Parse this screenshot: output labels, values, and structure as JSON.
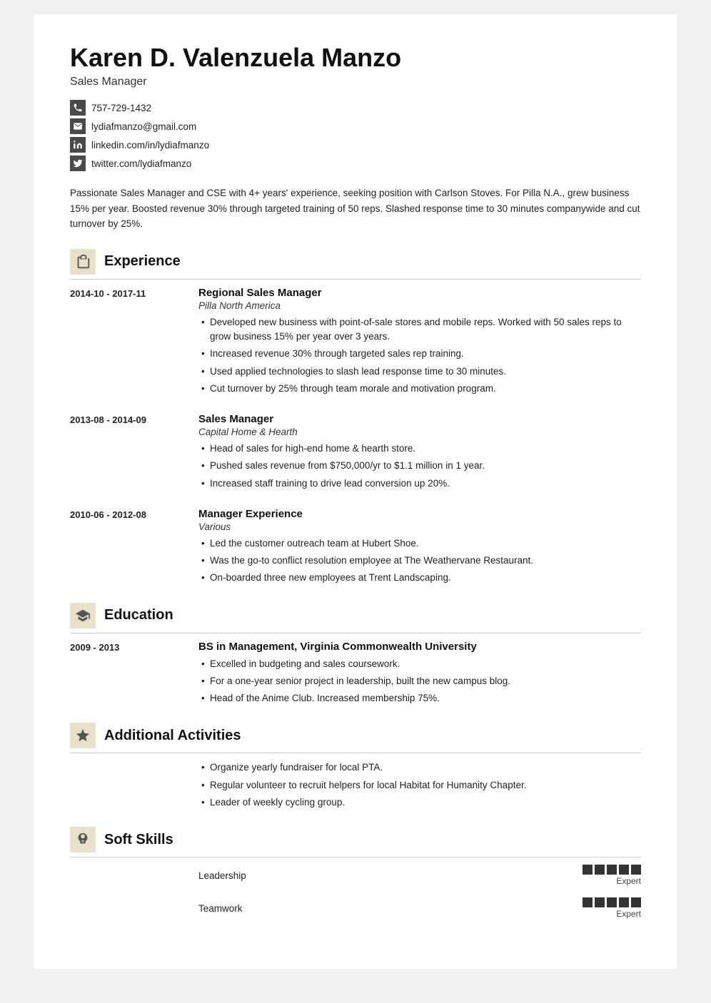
{
  "header": {
    "name": "Karen D. Valenzuela Manzo",
    "title": "Sales Manager",
    "phone": "757-729-1432",
    "email": "lydiafmanzo@gmail.com",
    "linkedin": "linkedin.com/in/lydiafmanzo",
    "twitter": "twitter.com/lydiafmanzo"
  },
  "summary": "Passionate Sales Manager and CSE with 4+ years' experience, seeking position with Carlson Stoves. For Pilla N.A., grew business 15% per year. Boosted revenue 30% through targeted training of 50 reps. Slashed response time to 30 minutes companywide and cut turnover by 25%.",
  "sections": {
    "experience": {
      "title": "Experience",
      "entries": [
        {
          "dates": "2014-10 - 2017-11",
          "job_title": "Regional Sales Manager",
          "company": "Pilla North America",
          "bullets": [
            "Developed new business with point-of-sale stores and mobile reps. Worked with 50 sales reps to grow business 15% per year over 3 years.",
            "Increased revenue 30% through targeted sales rep training.",
            "Used applied technologies to slash lead response time to 30 minutes.",
            "Cut turnover by 25% through team morale and motivation program."
          ]
        },
        {
          "dates": "2013-08 - 2014-09",
          "job_title": "Sales Manager",
          "company": "Capital Home & Hearth",
          "bullets": [
            "Head of sales for high-end home & hearth store.",
            "Pushed sales revenue from $750,000/yr to $1.1 million in 1 year.",
            "Increased staff training to drive lead conversion up 20%."
          ]
        },
        {
          "dates": "2010-06 - 2012-08",
          "job_title": "Manager Experience",
          "company": "Various",
          "bullets": [
            "Led the customer outreach team at Hubert Shoe.",
            "Was the go-to conflict resolution employee at The Weathervane Restaurant.",
            "On-boarded three new employees at Trent Landscaping."
          ]
        }
      ]
    },
    "education": {
      "title": "Education",
      "entries": [
        {
          "dates": "2009 - 2013",
          "degree": "BS in Management, Virginia Commonwealth University",
          "bullets": [
            "Excelled in budgeting and sales coursework.",
            "For a one-year senior project in leadership, built the new campus blog.",
            "Head of the Anime Club. Increased membership 75%."
          ]
        }
      ]
    },
    "activities": {
      "title": "Additional Activities",
      "bullets": [
        "Organize yearly fundraiser for local PTA.",
        "Regular volunteer to recruit helpers for local Habitat for Humanity Chapter.",
        "Leader of weekly cycling group."
      ]
    },
    "skills": {
      "title": "Soft Skills",
      "entries": [
        {
          "name": "Leadership",
          "dots": 5,
          "label": "Expert"
        },
        {
          "name": "Teamwork",
          "dots": 5,
          "label": "Expert"
        }
      ]
    }
  }
}
